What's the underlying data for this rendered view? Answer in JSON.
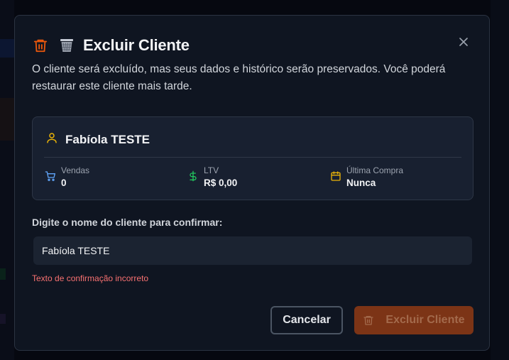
{
  "colors": {
    "accent": "#ea580c",
    "danger_button": "#7c3416",
    "error": "#f87171",
    "user_icon": "#eab308",
    "cart_icon": "#60a5fa",
    "dollar_icon": "#22c55e",
    "calendar_icon": "#eab308"
  },
  "dialog": {
    "title": "Excluir Cliente",
    "title_icons": [
      "trash-icon",
      "wastebasket-emoji-icon"
    ],
    "description": "O cliente será excluído, mas seus dados e histórico serão preservados. Você poderá restaurar este cliente mais tarde.",
    "close_icon": "close-icon"
  },
  "customer_card": {
    "name": "Fabíola TESTE",
    "icon": "user-icon",
    "stats": [
      {
        "icon": "cart-icon",
        "label": "Vendas",
        "value": "0"
      },
      {
        "icon": "dollar-icon",
        "label": "LTV",
        "value": "R$ 0,00"
      },
      {
        "icon": "calendar-icon",
        "label": "Última Compra",
        "value": "Nunca"
      }
    ]
  },
  "confirm": {
    "label": "Digite o nome do cliente para confirmar:",
    "value": "Fabíola TESTE",
    "error": "Texto de confirmação incorreto"
  },
  "actions": {
    "cancel_label": "Cancelar",
    "delete_label": "Excluir Cliente",
    "delete_icon": "trash-icon"
  }
}
